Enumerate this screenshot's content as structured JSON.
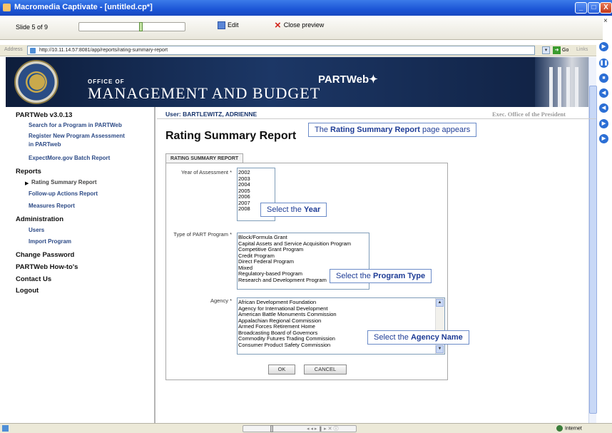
{
  "window": {
    "title": "Macromedia Captivate - [untitled.cp*]",
    "minimize": "_",
    "maximize": "□",
    "close": "X"
  },
  "toolbar": {
    "slide_counter": "Slide 5 of 9",
    "edit_label": "Edit",
    "close_preview_label": "Close preview",
    "close_glyph": "×",
    "slide_progress": 0.59
  },
  "address_bar": {
    "label": "Address",
    "url": "http://10.11.14.57:8081/app/reports/rating-summary-report",
    "go_label": "Go",
    "links_label": "Links"
  },
  "header": {
    "office_of": "OFFICE OF",
    "title": "MANAGEMENT AND BUDGET",
    "logo": "PARTWeb"
  },
  "sidebar": {
    "version": "PARTWeb v3.0.13",
    "links": {
      "search": "Search for a Program in PARTWeb",
      "register_1": "Register New Program Assessment",
      "register_2": "in PARTweb",
      "expectmore": "ExpectMore.gov Batch Report"
    },
    "reports_heading": "Reports",
    "reports": {
      "rating_summary": "Rating Summary Report",
      "followup": "Follow-up Actions Report",
      "measures": "Measures Report"
    },
    "admin_heading": "Administration",
    "admin": {
      "users": "Users",
      "import": "Import Program"
    },
    "change_password": "Change Password",
    "howto": "PARTWeb How-to's",
    "contact": "Contact Us",
    "logout": "Logout"
  },
  "user": {
    "label": "User: BARTLEWITZ, ADRIENNE",
    "org": "Exec. Office of the President"
  },
  "page": {
    "title": "Rating Summary Report"
  },
  "callouts": {
    "page_appears": {
      "pre": "The ",
      "bold": "Rating Summary Report",
      "post": " page appears"
    },
    "year": {
      "pre": "Select the ",
      "bold": "Year"
    },
    "program": {
      "pre": "Select the ",
      "bold": "Program Type"
    },
    "agency": {
      "pre": "Select the ",
      "bold": "Agency Name"
    }
  },
  "form": {
    "tab_label": "RATING SUMMARY REPORT",
    "year_label": "Year of Assessment",
    "years": [
      "2002",
      "2003",
      "2004",
      "2005",
      "2006",
      "2007",
      "2008"
    ],
    "program_type_label": "Type of PART Program",
    "program_types": [
      "Block/Formula Grant",
      "Capital Assets and Service Acquisition Program",
      "Competitive Grant Program",
      "Credit Program",
      "Direct Federal Program",
      "Mixed",
      "Regulatory-based Program",
      "Research and Development Program"
    ],
    "agency_label": "Agency",
    "agencies": [
      "African Development Foundation",
      "Agency for International Development",
      "American Battle Monuments Commission",
      "Appalachian Regional Commission",
      "Armed Forces Retirement Home",
      "Broadcasting Board of Governors",
      "Commodity Futures Trading Commission",
      "Consumer Product Safety Commission"
    ],
    "required_marker": "*",
    "ok_label": "OK",
    "cancel_label": "CANCEL"
  },
  "status_bar": {
    "zone": "Internet"
  }
}
